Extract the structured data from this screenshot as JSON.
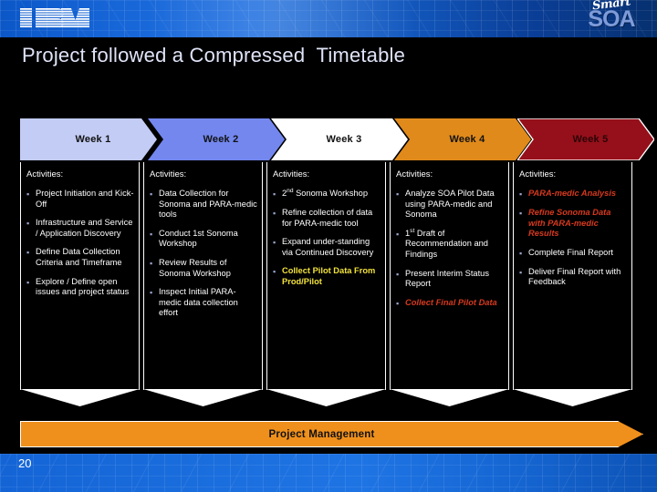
{
  "branding": {
    "ibm_logo": "ibm-logo",
    "smart_text": "Smart",
    "soa_text": "SOA"
  },
  "slide": {
    "title": "Project followed a Compressed  Timetable",
    "page_number": "20",
    "activities_label": "Activities:"
  },
  "colors": {
    "week1": "#c3ccf5",
    "week2": "#7387ef",
    "week3": "#ffffff",
    "week4": "#e08a1b",
    "week5": "#95101a",
    "highlight_yellow": "#f2e23c",
    "highlight_red": "#d7391f",
    "pm_bar": "#f0901c",
    "banner_blue": "#1766d8"
  },
  "timeline": {
    "phases": [
      {
        "label": "Week 1",
        "color": "#c3ccf5",
        "activities_label": "Activities:",
        "items": [
          {
            "text": "Project Initiation and Kick-Off",
            "style": "normal"
          },
          {
            "text": "Infrastructure and Service / Application Discovery",
            "style": "normal"
          },
          {
            "text": "Define Data Collection Criteria and Timeframe",
            "style": "normal"
          },
          {
            "text": "Explore / Define open issues and project status",
            "style": "normal"
          }
        ]
      },
      {
        "label": "Week 2",
        "color": "#7387ef",
        "activities_label": "Activities:",
        "items": [
          {
            "text": "Data Collection for Sonoma and PARA-medic tools",
            "style": "normal"
          },
          {
            "text": "Conduct 1st Sonoma Workshop",
            "style": "normal"
          },
          {
            "text": "Review Results of Sonoma Workshop",
            "style": "normal"
          },
          {
            "text": "Inspect Initial PARA-medic data collection effort",
            "style": "normal"
          }
        ]
      },
      {
        "label": "Week 3",
        "color": "#ffffff",
        "activities_label": "Activities:",
        "items": [
          {
            "text": "2nd Sonoma Workshop",
            "style": "normal",
            "sup": "nd",
            "prefix": "2",
            "suffix": " Sonoma Workshop"
          },
          {
            "text": "Refine collection of data for PARA-medic tool",
            "style": "normal"
          },
          {
            "text": "Expand under-standing via Continued Discovery",
            "style": "normal"
          },
          {
            "text": "Collect Pilot Data From Prod/Pilot",
            "style": "yellow"
          }
        ]
      },
      {
        "label": "Week 4",
        "color": "#e08a1b",
        "activities_label": "Activities:",
        "items": [
          {
            "text": "Analyze SOA Pilot Data using PARA-medic and Sonoma",
            "style": "normal"
          },
          {
            "text": "1st Draft of Recommendation and Findings",
            "style": "normal",
            "sup": "st",
            "prefix": "1",
            "suffix": " Draft of Recommendation and Findings"
          },
          {
            "text": "Present Interim Status Report",
            "style": "normal"
          },
          {
            "text": "Collect Final Pilot Data",
            "style": "red"
          }
        ]
      },
      {
        "label": "Week 5",
        "color": "#95101a",
        "activities_label": "Activities:",
        "items": [
          {
            "text": "PARA-medic Analysis",
            "style": "red"
          },
          {
            "text": "Refine Sonoma Data with PARA-medic Results",
            "style": "red"
          },
          {
            "text": "Complete Final Report",
            "style": "normal"
          },
          {
            "text": "Deliver Final Report with Feedback",
            "style": "normal"
          }
        ]
      }
    ]
  },
  "project_management_bar": {
    "label": "Project Management"
  }
}
